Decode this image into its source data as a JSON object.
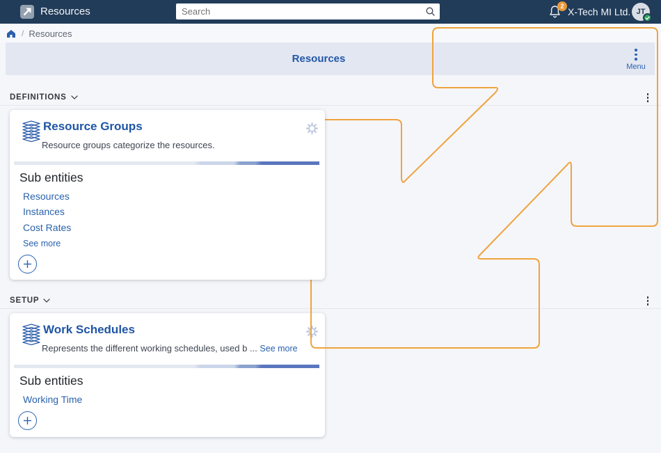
{
  "navbar": {
    "app_title": "Resources",
    "search": {
      "placeholder": "Search"
    },
    "notifications": {
      "count": "2"
    },
    "org_name": "X-Tech MI Ltd.",
    "avatar_initials": "JT"
  },
  "breadcrumb": {
    "separator": "/",
    "current": "Resources"
  },
  "page_header": {
    "title": "Resources",
    "menu_label": "Menu"
  },
  "sections": {
    "definitions": {
      "label": "DEFINITIONS"
    },
    "setup": {
      "label": "SETUP"
    }
  },
  "cards": [
    {
      "title": "Resource Groups",
      "description": "Resource groups categorize the resources.",
      "sub_entities_label": "Sub entities",
      "links": [
        "Resources",
        "Instances",
        "Cost Rates"
      ],
      "see_more_label": "See more"
    },
    {
      "title": "Work Schedules",
      "description": "Represents the different working schedules, used b ...",
      "see_more_label": "See more",
      "sub_entities_label": "Sub entities",
      "links": [
        "Working Time"
      ]
    }
  ],
  "colors": {
    "annotation_orange": "#efa33d",
    "brand_blue": "#2257a7",
    "navbar_bg": "#213c59"
  }
}
